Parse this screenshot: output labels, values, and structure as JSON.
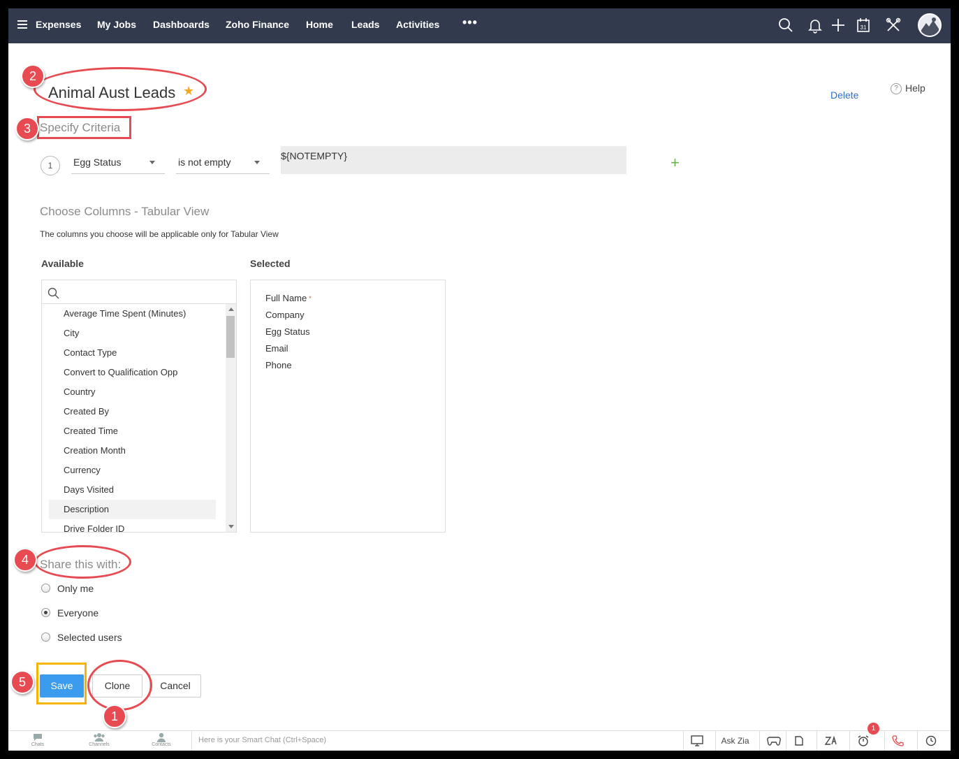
{
  "nav": {
    "items": [
      "Expenses",
      "My Jobs",
      "Dashboards",
      "Zoho Finance",
      "Home",
      "Leads",
      "Activities"
    ],
    "more": "•••",
    "calendar_day": "31"
  },
  "view": {
    "title": "Animal Aust Leads",
    "delete_label": "Delete",
    "help_label": "Help",
    "help_icon": "?"
  },
  "criteria": {
    "heading": "Specify Criteria",
    "row_number": "1",
    "field": "Egg Status",
    "operator": "is not empty",
    "value": "${NOTEMPTY}",
    "add_symbol": "+"
  },
  "columns": {
    "heading": "Choose Columns - Tabular View",
    "note": "The columns you choose will be applicable only for Tabular View",
    "available_label": "Available",
    "selected_label": "Selected",
    "available": [
      "Average Time Spent (Minutes)",
      "City",
      "Contact Type",
      "Convert to Qualification Opp",
      "Country",
      "Created By",
      "Created Time",
      "Creation Month",
      "Currency",
      "Days Visited",
      "Description",
      "Drive Folder ID"
    ],
    "selected": [
      "Full Name",
      "Company",
      "Egg Status",
      "Email",
      "Phone"
    ],
    "required_mark": "*"
  },
  "share": {
    "heading": "Share this with:",
    "options": [
      "Only me",
      "Everyone",
      "Selected users"
    ],
    "selected": "Everyone"
  },
  "buttons": {
    "save": "Save",
    "clone": "Clone",
    "cancel": "Cancel"
  },
  "annotations": [
    "1",
    "2",
    "3",
    "4",
    "5"
  ],
  "bottom": {
    "tabs": [
      "Chats",
      "Channels",
      "Contacts"
    ],
    "smart_chat_placeholder": "Here is your Smart Chat (Ctrl+Space)",
    "ask_zia": "Ask Zia",
    "notification_count": "1"
  },
  "colors": {
    "nav_bg": "#323b4e",
    "save_blue": "#3b9bec",
    "annotation_red": "#e84a52",
    "highlight_yellow": "#f4b400",
    "star": "#f5a623",
    "link": "#2b70c9"
  }
}
